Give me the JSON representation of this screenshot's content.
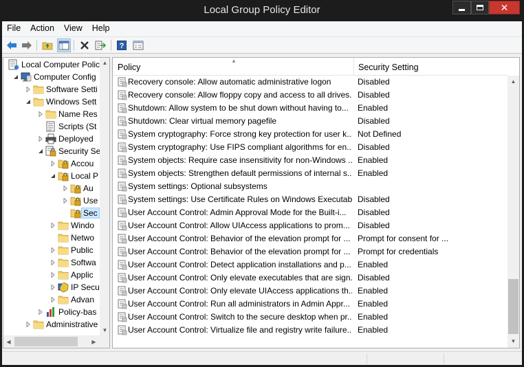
{
  "window": {
    "title": "Local Group Policy Editor"
  },
  "menu": [
    "File",
    "Action",
    "View",
    "Help"
  ],
  "toolbar": [
    {
      "icon": "back-arrow-icon"
    },
    {
      "icon": "forward-arrow-icon"
    },
    {
      "icon": "up-folder-icon"
    },
    {
      "icon": "show-hide-tree-icon"
    },
    {
      "icon": "delete-icon"
    },
    {
      "icon": "export-list-icon"
    },
    {
      "icon": "help-icon"
    },
    {
      "icon": "properties-icon"
    }
  ],
  "tree": [
    {
      "label": "Local Computer Polic",
      "icon": "policy-root-icon",
      "level": 0,
      "expander": "none"
    },
    {
      "label": "Computer Config",
      "icon": "computer-icon",
      "level": 1,
      "expander": "expanded"
    },
    {
      "label": "Software Setti",
      "icon": "folder-icon",
      "level": 2,
      "expander": "collapsed"
    },
    {
      "label": "Windows Sett",
      "icon": "folder-icon",
      "level": 2,
      "expander": "expanded"
    },
    {
      "label": "Name Res",
      "icon": "folder-icon",
      "level": 3,
      "expander": "collapsed"
    },
    {
      "label": "Scripts (St",
      "icon": "scripts-icon",
      "level": 3,
      "expander": "none"
    },
    {
      "label": "Deployed",
      "icon": "printer-icon",
      "level": 3,
      "expander": "collapsed"
    },
    {
      "label": "Security Se",
      "icon": "security-icon",
      "level": 3,
      "expander": "expanded"
    },
    {
      "label": "Accou",
      "icon": "lock-folder-icon",
      "level": 4,
      "expander": "collapsed"
    },
    {
      "label": "Local P",
      "icon": "lock-folder-icon",
      "level": 4,
      "expander": "expanded"
    },
    {
      "label": "Au",
      "icon": "lock-folder-icon",
      "level": 5,
      "expander": "collapsed"
    },
    {
      "label": "Use",
      "icon": "lock-folder-icon",
      "level": 5,
      "expander": "collapsed"
    },
    {
      "label": "Sec",
      "icon": "lock-folder-icon",
      "level": 5,
      "expander": "none",
      "selected": true
    },
    {
      "label": "Windo",
      "icon": "folder-icon",
      "level": 4,
      "expander": "collapsed"
    },
    {
      "label": "Netwo",
      "icon": "folder-icon",
      "level": 4,
      "expander": "none"
    },
    {
      "label": "Public",
      "icon": "folder-icon",
      "level": 4,
      "expander": "collapsed"
    },
    {
      "label": "Softwa",
      "icon": "folder-icon",
      "level": 4,
      "expander": "collapsed"
    },
    {
      "label": "Applic",
      "icon": "folder-icon",
      "level": 4,
      "expander": "collapsed"
    },
    {
      "label": "IP Secu",
      "icon": "ip-security-icon",
      "level": 4,
      "expander": "collapsed"
    },
    {
      "label": "Advan",
      "icon": "folder-icon",
      "level": 4,
      "expander": "collapsed"
    },
    {
      "label": "Policy-bas",
      "icon": "chart-icon",
      "level": 3,
      "expander": "collapsed"
    },
    {
      "label": "Administrative",
      "icon": "folder-icon",
      "level": 2,
      "expander": "collapsed"
    }
  ],
  "columns": {
    "policy": "Policy",
    "setting": "Security Setting"
  },
  "policies": [
    {
      "name": "Recovery console: Allow automatic administrative logon",
      "value": "Disabled"
    },
    {
      "name": "Recovery console: Allow floppy copy and access to all drives...",
      "value": "Disabled"
    },
    {
      "name": "Shutdown: Allow system to be shut down without having to...",
      "value": "Enabled"
    },
    {
      "name": "Shutdown: Clear virtual memory pagefile",
      "value": "Disabled"
    },
    {
      "name": "System cryptography: Force strong key protection for user k...",
      "value": "Not Defined"
    },
    {
      "name": "System cryptography: Use FIPS compliant algorithms for en...",
      "value": "Disabled"
    },
    {
      "name": "System objects: Require case insensitivity for non-Windows ...",
      "value": "Enabled"
    },
    {
      "name": "System objects: Strengthen default permissions of internal s...",
      "value": "Enabled"
    },
    {
      "name": "System settings: Optional subsystems",
      "value": ""
    },
    {
      "name": "System settings: Use Certificate Rules on Windows Executabl...",
      "value": "Disabled"
    },
    {
      "name": "User Account Control: Admin Approval Mode for the Built-i...",
      "value": "Disabled"
    },
    {
      "name": "User Account Control: Allow UIAccess applications to prom...",
      "value": "Disabled"
    },
    {
      "name": "User Account Control: Behavior of the elevation prompt for ...",
      "value": "Prompt for consent for ..."
    },
    {
      "name": "User Account Control: Behavior of the elevation prompt for ...",
      "value": "Prompt for credentials"
    },
    {
      "name": "User Account Control: Detect application installations and p...",
      "value": "Enabled"
    },
    {
      "name": "User Account Control: Only elevate executables that are sign...",
      "value": "Disabled"
    },
    {
      "name": "User Account Control: Only elevate UIAccess applications th...",
      "value": "Enabled"
    },
    {
      "name": "User Account Control: Run all administrators in Admin Appr...",
      "value": "Enabled"
    },
    {
      "name": "User Account Control: Switch to the secure desktop when pr...",
      "value": "Enabled"
    },
    {
      "name": "User Account Control: Virtualize file and registry write failure...",
      "value": "Enabled"
    }
  ]
}
